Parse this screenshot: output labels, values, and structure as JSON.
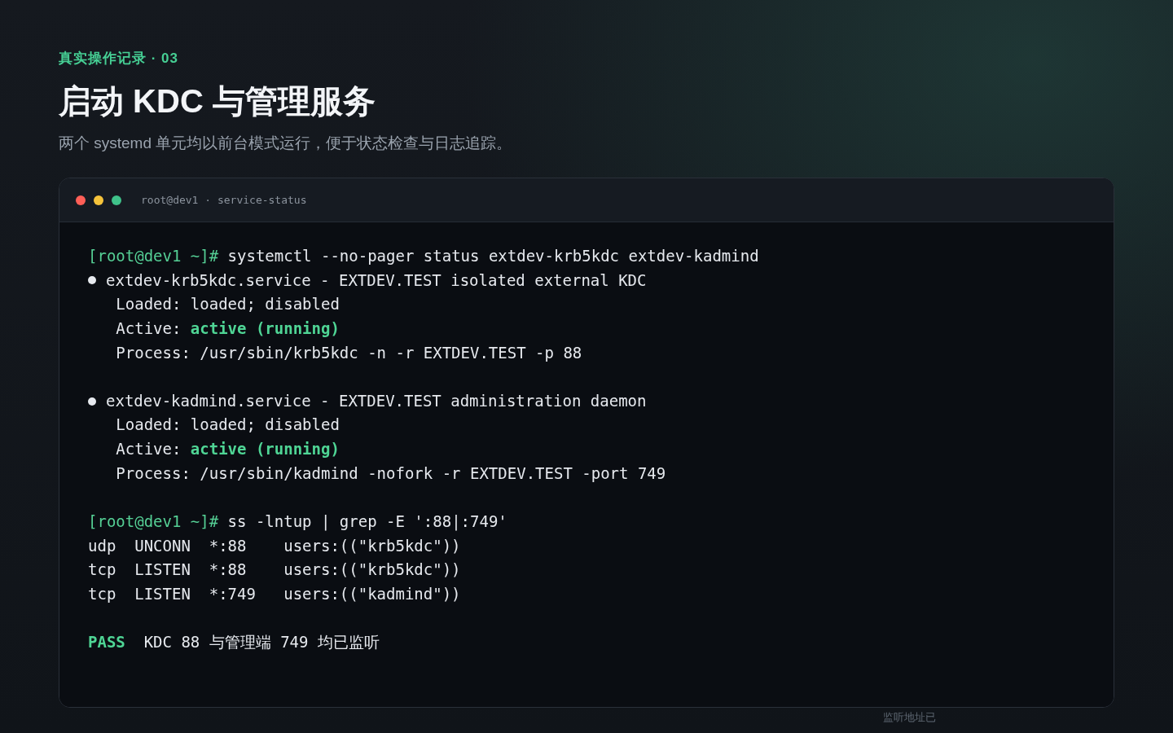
{
  "eyebrow": "真实操作记录 · 03",
  "title": "启动 KDC 与管理服务",
  "subtitle": "两个 systemd 单元均以前台模式运行，便于状态检查与日志追踪。",
  "terminal": {
    "title": "root@dev1 · service-status",
    "blocks": [
      {
        "lines": [
          {
            "kind": "prompt",
            "prompt": "[root@dev1 ~]#",
            "command": "systemctl --no-pager status extdev-krb5kdc extdev-kadmind"
          },
          {
            "kind": "unit",
            "text": "extdev-krb5kdc.service - EXTDEV.TEST isolated external KDC"
          },
          {
            "kind": "detail",
            "text": "Loaded: loaded; disabled"
          },
          {
            "kind": "detail",
            "text": "Active: **active (running)**"
          },
          {
            "kind": "detail",
            "text": "Process: /usr/sbin/krb5kdc -n -r EXTDEV.TEST -p 88"
          }
        ]
      },
      {
        "lines": [
          {
            "kind": "unit",
            "text": "extdev-kadmind.service - EXTDEV.TEST administration daemon"
          },
          {
            "kind": "detail",
            "text": "Loaded: loaded; disabled"
          },
          {
            "kind": "detail",
            "text": "Active: **active (running)**"
          },
          {
            "kind": "detail",
            "text": "Process: /usr/sbin/kadmind -nofork -r EXTDEV.TEST -port 749"
          }
        ]
      },
      {
        "lines": [
          {
            "kind": "prompt",
            "prompt": "[root@dev1 ~]#",
            "command": "ss -lntup | grep -E ':88|:749'"
          },
          {
            "kind": "plain",
            "text": "udp  UNCONN  *:88    users:((\"krb5kdc\"))"
          },
          {
            "kind": "plain",
            "text": "tcp  LISTEN  *:88    users:((\"krb5kdc\"))"
          },
          {
            "kind": "plain",
            "text": "tcp  LISTEN  *:749   users:((\"kadmind\"))"
          }
        ]
      },
      {
        "lines": [
          {
            "kind": "result",
            "badge": "PASS",
            "text": "KDC 88 与管理端 749 均已监听"
          }
        ]
      }
    ]
  },
  "footnote": "监听地址已"
}
